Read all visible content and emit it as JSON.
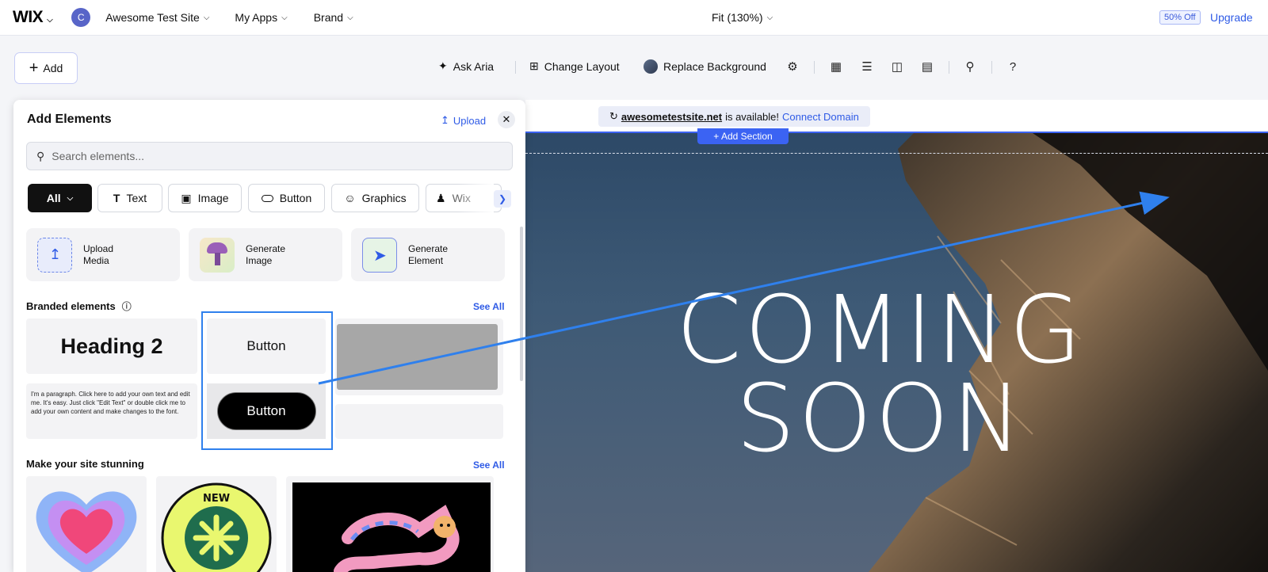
{
  "topbar": {
    "logo": "WIX",
    "avatar_letter": "C",
    "site_name": "Awesome Test Site",
    "apps_label": "My Apps",
    "brand_label": "Brand",
    "zoom_label": "Fit (130%)",
    "discount_badge": "50% Off",
    "upgrade_label": "Upgrade"
  },
  "toolbar": {
    "add_label": "Add",
    "ask_aria": "Ask Aria",
    "change_layout": "Change Layout",
    "replace_background": "Replace Background",
    "help": "?"
  },
  "canvas": {
    "domain_name": "awesometestsite.net",
    "domain_available": "is available!",
    "connect_domain": "Connect Domain",
    "add_section": "+ Add Section",
    "hero_line1": "COMING",
    "hero_line2": "SOON"
  },
  "panel": {
    "title": "Add Elements",
    "upload_label": "Upload",
    "search_placeholder": "Search elements...",
    "filters": [
      "All",
      "Text",
      "Image",
      "Button",
      "Graphics",
      "Wix"
    ],
    "quick_actions": [
      "Upload Media",
      "Generate Image",
      "Generate Element"
    ],
    "branded_title": "Branded elements",
    "see_all": "See All",
    "heading2": "Heading 2",
    "button_plain": "Button",
    "button_black": "Button",
    "paragraph": "I'm a paragraph. Click here to add your own text and edit me. It's easy. Just click \"Edit Text\" or double click me to add your own content and make changes to the font.",
    "stunning_title": "Make your site stunning",
    "badge_text": "NEW"
  },
  "colors": {
    "accent": "#2f5be6",
    "selection": "#2f80ed",
    "arrow": "#2f80ed"
  }
}
